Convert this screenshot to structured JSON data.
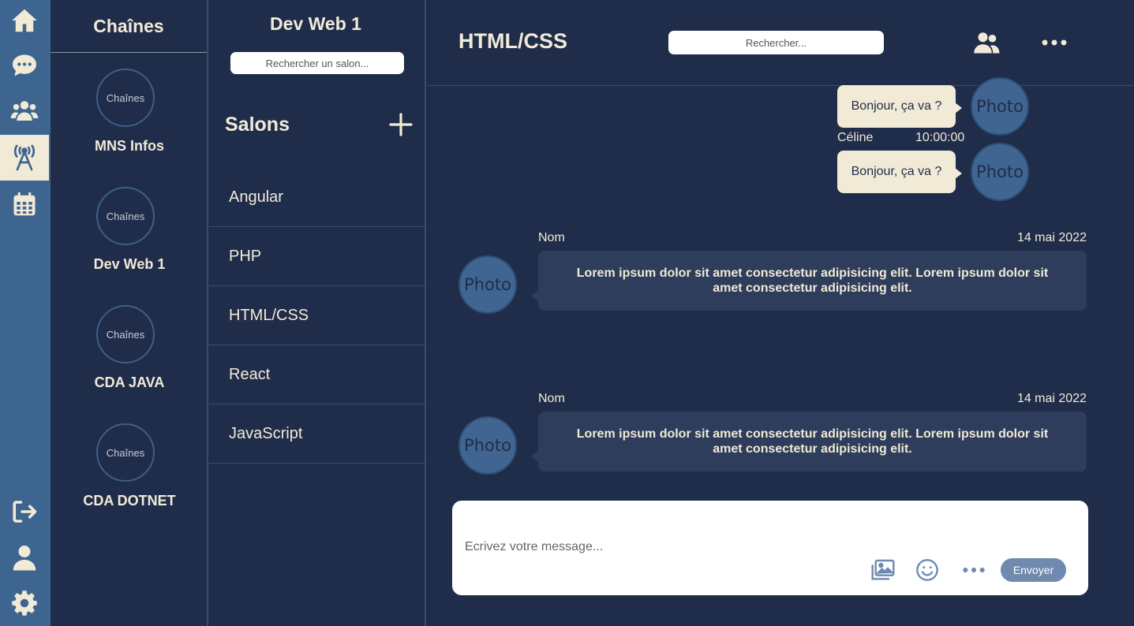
{
  "colors": {
    "navy": "#1f2d4b",
    "rail_blue": "#3e6590",
    "cream": "#f1ead6",
    "bubble_dark": "#2d3d5b",
    "send_button": "#6f8aae"
  },
  "rail": {
    "items": [
      {
        "icon": "home-icon"
      },
      {
        "icon": "chat-icon"
      },
      {
        "icon": "users-icon"
      },
      {
        "icon": "broadcast-tower-icon",
        "active": true
      },
      {
        "icon": "calendar-icon"
      },
      {
        "icon": "logout-icon"
      },
      {
        "icon": "user-icon"
      },
      {
        "icon": "gear-icon"
      }
    ]
  },
  "channels": {
    "title": "Chaînes",
    "items": [
      {
        "avatar_text": "Chaînes",
        "name": "MNS Infos"
      },
      {
        "avatar_text": "Chaînes",
        "name": "Dev Web 1"
      },
      {
        "avatar_text": "Chaînes",
        "name": "CDA JAVA"
      },
      {
        "avatar_text": "Chaînes",
        "name": "CDA DOTNET"
      }
    ]
  },
  "rooms": {
    "title": "Dev Web 1",
    "search_placeholder": "Rechercher un salon...",
    "section_title": "Salons",
    "items": [
      "Angular",
      "PHP",
      "HTML/CSS",
      "React",
      "JavaScript"
    ]
  },
  "main": {
    "title": "HTML/CSS",
    "search_placeholder": "Rechercher...",
    "own_messages": [
      {
        "text": "Bonjour, ça va ?",
        "photo": "Photo"
      },
      {
        "author": "Céline",
        "time": "10:00:00",
        "text": "Bonjour, ça va ?",
        "photo": "Photo"
      }
    ],
    "messages": [
      {
        "author": "Nom",
        "date": "14 mai 2022",
        "photo": "Photo",
        "text": "Lorem ipsum dolor sit amet consectetur adipisicing elit. Lorem ipsum dolor sit amet consectetur adipisicing elit."
      },
      {
        "author": "Nom",
        "date": "14 mai 2022",
        "photo": "Photo",
        "text": "Lorem ipsum dolor sit amet consectetur adipisicing elit. Lorem ipsum dolor sit amet consectetur adipisicing elit."
      }
    ],
    "composer": {
      "placeholder": "Ecrivez votre message...",
      "send_label": "Envoyer"
    }
  }
}
